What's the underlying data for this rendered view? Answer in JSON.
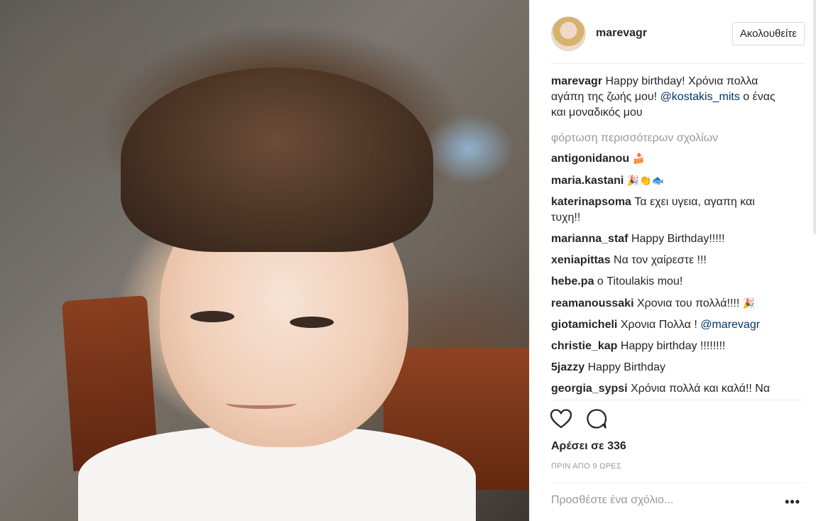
{
  "post": {
    "username": "marevagr",
    "follow_label": "Ακολουθείτε",
    "caption_user": "marevagr",
    "caption_text": "Happy birthday! Χρόνια πολλα αγάπη της ζωής μου!",
    "caption_mention": "@kostakis_mits",
    "caption_tail": "ο ένας και μοναδικός μου",
    "load_more": "φόρτωση περισσότερων σχολίων",
    "likes": "Αρέσει σε 336",
    "time": "ΠΡΙΝ ΑΠΟ 9 ΩΡΕΣ",
    "add_comment_placeholder": "Προσθέστε ένα σχόλιο...",
    "more_label": "•••"
  },
  "comments": [
    {
      "user": "antigonidanou",
      "text": "",
      "emoji": "🍰"
    },
    {
      "user": "maria.kastani",
      "text": "",
      "emoji": "🎉👏🐟"
    },
    {
      "user": "katerinapsoma",
      "text": "Τα εχει υγεια, αγαπη και τυχη!!",
      "emoji": ""
    },
    {
      "user": "marianna_staf",
      "text": "Happy Birthday!!!!!",
      "emoji": ""
    },
    {
      "user": "xeniapittas",
      "text": "Να τον χαίρεστε !!!",
      "emoji": ""
    },
    {
      "user": "hebe.pa",
      "text": "ο Titoulakis mou!",
      "emoji": ""
    },
    {
      "user": "reamanoussaki",
      "text": "Χρονια του πολλά!!!!",
      "emoji": "🎉"
    },
    {
      "user": "giotamicheli",
      "text": "Χρονια Πολλα !",
      "mention": "@marevagr",
      "emoji": ""
    },
    {
      "user": "christie_kap",
      "text": "Happy birthday !!!!!!!!",
      "emoji": ""
    },
    {
      "user": "5jazzy",
      "text": "Happy Birthday",
      "emoji": ""
    },
    {
      "user": "georgia_sypsi",
      "text": "Χρόνια πολλά και καλά!! Να τον χαιρόμαστε!",
      "emoji": "😊😍✨❤️"
    }
  ]
}
